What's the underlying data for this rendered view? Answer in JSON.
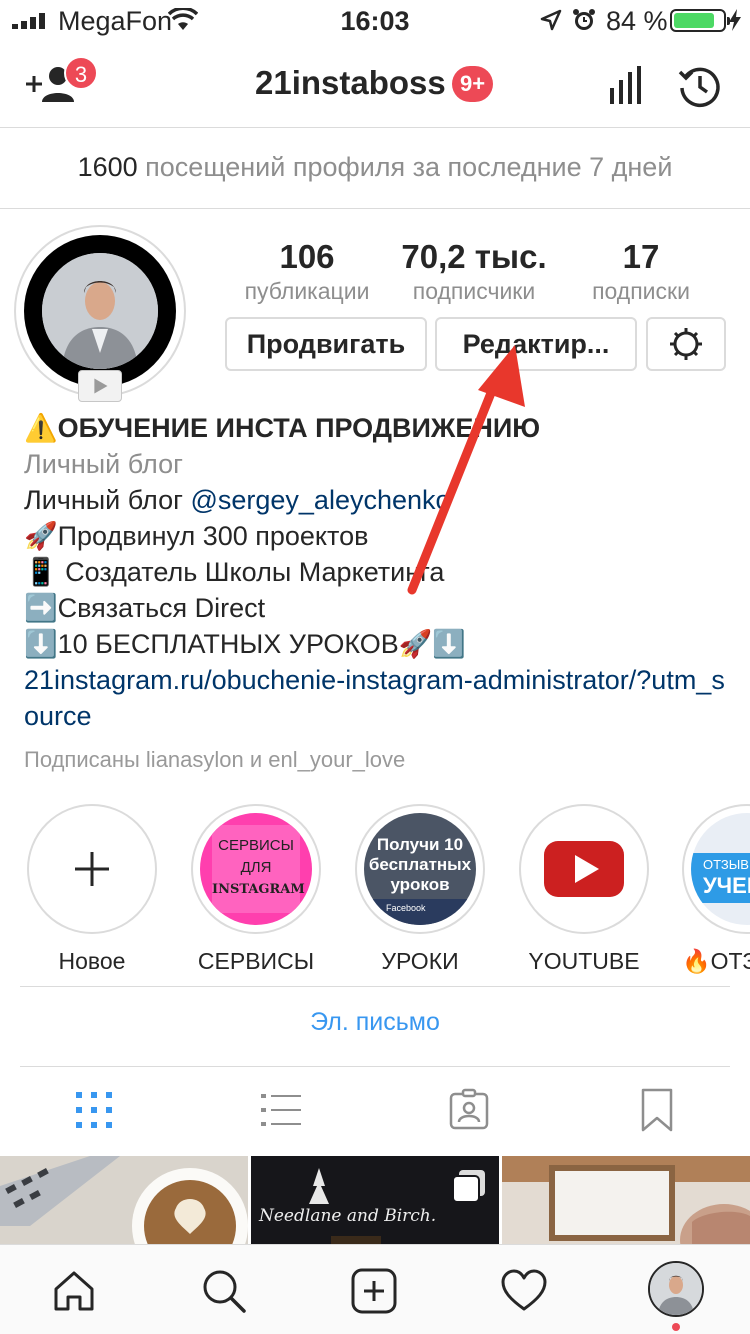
{
  "status_bar": {
    "carrier": "MegaFon",
    "time": "16:03",
    "battery": "84 %"
  },
  "header": {
    "username": "21instaboss",
    "notifications_badge": "3",
    "unread_badge": "9+"
  },
  "visits": {
    "count": "1600",
    "text": "посещений профиля за последние 7 дней"
  },
  "stats": [
    {
      "value": "106",
      "label": "публикации"
    },
    {
      "value": "70,2 тыс.",
      "label": "подписчики"
    },
    {
      "value": "17",
      "label": "подписки"
    }
  ],
  "buttons": {
    "promote": "Продвигать",
    "edit": "Редактир..."
  },
  "bio": {
    "name": "⚠️ОБУЧЕНИЕ ИНСТА ПРОДВИЖЕНИЮ",
    "category": "Личный блог",
    "line1_prefix": "Личный блог",
    "line1_mention": "@sergey_aleychenko",
    "line2": "🚀Продвинул 300 проектов",
    "line3": "📱 Создатель Школы Маркетинга",
    "line4": "➡️Связаться Direct",
    "line5": "⬇️10 БЕСПЛАТНЫХ УРОКОВ🚀⬇️",
    "link": "21instagram.ru/obuchenie-instagram-administrator/?utm_source",
    "followed_by": "Подписаны lianasylon и enl_your_love"
  },
  "highlights": [
    {
      "label": "Новое"
    },
    {
      "label": "СЕРВИСЫ",
      "cover_line1": "СЕРВИСЫ",
      "cover_line2": "ДЛЯ",
      "cover_line3": "INSTAGRAM"
    },
    {
      "label": "УРОКИ",
      "cover_line1": "Получи 10",
      "cover_line2": "бесплатных",
      "cover_line3": "уроков",
      "cover_footer": "Facebook"
    },
    {
      "label": "YOUTUBE"
    },
    {
      "label": "🔥ОТЗ",
      "cover_line1": "ОТЗЫВ Н",
      "cover_line2": "УЧЕН"
    }
  ],
  "email_button": "Эл. письмо",
  "grid_post_text": "Needlane and Birch.",
  "colors": {
    "accent": "#3897f0",
    "badge": "#ed4956",
    "link": "#003569",
    "arrow": "#e8372c",
    "battery": "#4cd964"
  }
}
